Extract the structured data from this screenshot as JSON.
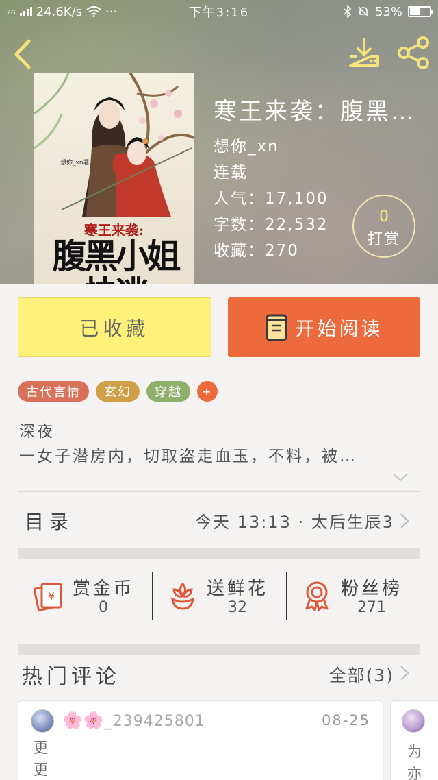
{
  "status_bar": {
    "network": "2G",
    "speed": "24.6K/s",
    "more": "···",
    "time": "下午3:16",
    "battery": "53%",
    "battery_level": 0.53
  },
  "book": {
    "title": "寒王来袭：腹黑小…",
    "author": "想你_xn",
    "status": "连载",
    "popularity": "人气：17,100",
    "word_count": "字数：22,532",
    "favorites": "收藏：270",
    "cover": {
      "title_line1": "寒王来袭:",
      "title_line2": "腹黑小姐快逃",
      "credit": "想你_xn著"
    }
  },
  "reward": {
    "count": "0",
    "label": "打赏"
  },
  "actions": {
    "collected_label": "已收藏",
    "read_label": "开始阅读"
  },
  "tags": [
    {
      "label": "古代言情",
      "color": "#d8705a"
    },
    {
      "label": "玄幻",
      "color": "#cfa047"
    },
    {
      "label": "穿越",
      "color": "#8fb06a"
    },
    {
      "label": "+",
      "color": "#ec6a3c"
    }
  ],
  "synopsis": {
    "line1": "深夜",
    "line2": "一女子潜房内，切取盗走血玉，不料，被…"
  },
  "toc": {
    "label": "目录",
    "latest": "今天 13:13 · 太后生辰3"
  },
  "stats": [
    {
      "label": "赏金币",
      "value": "0",
      "icon": "red-envelope-icon"
    },
    {
      "label": "送鲜花",
      "value": "32",
      "icon": "flower-icon"
    },
    {
      "label": "粉丝榜",
      "value": "271",
      "icon": "medal-icon"
    }
  ],
  "comments": {
    "title": "热门评论",
    "all_label": "全部(3)",
    "items": [
      {
        "user_flowers": "🌸🌸",
        "user": "_239425801",
        "date": "08-25",
        "text": "更更"
      },
      {
        "text": "为亦"
      }
    ]
  },
  "colors": {
    "accent_orange": "#ec6a3c",
    "collected_yellow": "#fdf17a",
    "icon_yellow": "#f5e27a",
    "stat_icon_red": "#e0583a"
  }
}
